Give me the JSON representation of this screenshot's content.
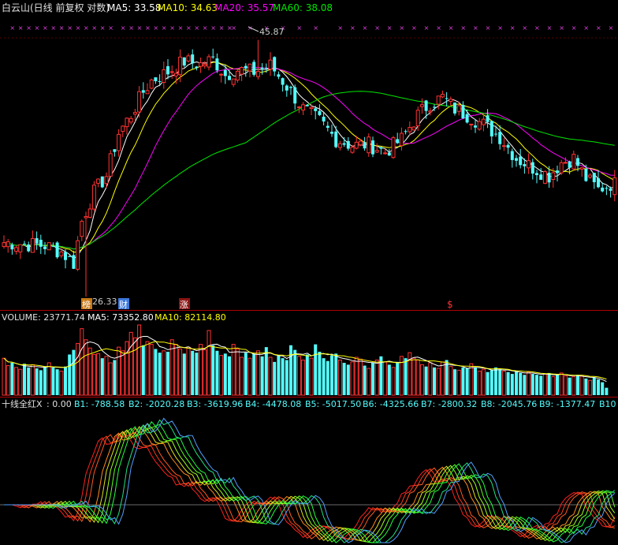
{
  "header": {
    "title": "白云山(日线 前复权 对数)",
    "ma5_label": "MA5: 33.58",
    "ma10_label": "MA10: 34.63",
    "ma20_label": "MA20: 35.57",
    "ma60_label": "MA60: 38.08"
  },
  "volume_header": {
    "volume_label": "VOLUME: 23771.74",
    "ma5_label": "MA5: 73352.80",
    "ma10_label": "MA10: 82114.80"
  },
  "indicator_header": {
    "name": "十线全红X",
    "items": [
      ": 0.00",
      "B1: -788.58",
      "B2: -2020.28",
      "B3: -3619.96",
      "B4: -4478.08",
      "B5: -5017.50",
      "B6: -4325.66",
      "B7: -2800.32",
      "B8: -2045.76",
      "B9: -1377.47",
      "B10"
    ]
  },
  "annotations": {
    "high_label": "45.87",
    "low_label": "26.33",
    "tag_bang": "榜",
    "tag_cai": "财",
    "tag_zhang": "涨",
    "tag_dollar": "$"
  },
  "colors": {
    "up": "#ff3232",
    "down": "#54fcfc",
    "ma5": "#ffffff",
    "ma10": "#ffff00",
    "ma20": "#ff00ff",
    "ma60": "#00e600",
    "marker": "#e040e0"
  },
  "chart_data": [
    {
      "type": "candlestick",
      "title": "白云山(日线 前复权 对数)",
      "scale": "log",
      "ylim": [
        25.8,
        48.0
      ],
      "summary": {
        "high": 45.87,
        "low": 26.33
      },
      "series": [
        {
          "name": "MA5",
          "last": 33.58
        },
        {
          "name": "MA10",
          "last": 34.63
        },
        {
          "name": "MA20",
          "last": 35.57
        },
        {
          "name": "MA60",
          "last": 38.08
        }
      ],
      "key_closes": [
        [
          0,
          29.6
        ],
        [
          10,
          29.4
        ],
        [
          14,
          29.0
        ],
        [
          17,
          28.3
        ],
        [
          19,
          31.0
        ],
        [
          22,
          33.0
        ],
        [
          25,
          34.2
        ],
        [
          28,
          37.5
        ],
        [
          31,
          39.0
        ],
        [
          34,
          41.0
        ],
        [
          36,
          42.0
        ],
        [
          40,
          42.8
        ],
        [
          44,
          43.8
        ],
        [
          48,
          43.5
        ],
        [
          51,
          44.0
        ],
        [
          54,
          42.5
        ],
        [
          57,
          43.0
        ],
        [
          61,
          42.8
        ],
        [
          65,
          43.4
        ],
        [
          69,
          41.5
        ],
        [
          73,
          39.5
        ],
        [
          77,
          38.5
        ],
        [
          81,
          37.0
        ],
        [
          85,
          36.5
        ],
        [
          89,
          36.6
        ],
        [
          93,
          36.0
        ],
        [
          97,
          37.0
        ],
        [
          101,
          39.0
        ],
        [
          104,
          40.0
        ],
        [
          107,
          40.5
        ],
        [
          110,
          39.5
        ],
        [
          113,
          39.0
        ],
        [
          117,
          38.2
        ],
        [
          121,
          37.2
        ],
        [
          125,
          35.5
        ],
        [
          129,
          34.8
        ],
        [
          133,
          34.2
        ],
        [
          136,
          35.2
        ],
        [
          139,
          35.5
        ],
        [
          142,
          34.0
        ],
        [
          145,
          33.2
        ],
        [
          148,
          33.6
        ]
      ]
    },
    {
      "type": "bar",
      "title": "VOLUME",
      "values": [
        40,
        32,
        35,
        30,
        28,
        34,
        30,
        33,
        29,
        27,
        31,
        35,
        30,
        28,
        26,
        31,
        44,
        49,
        56,
        72,
        60,
        51,
        44,
        45,
        40,
        42,
        35,
        38,
        52,
        48,
        58,
        68,
        62,
        76,
        54,
        58,
        55,
        50,
        46,
        48,
        47,
        60,
        55,
        50,
        45,
        52,
        48,
        46,
        55,
        49,
        70,
        54,
        48,
        43,
        45,
        42,
        55,
        50,
        41,
        46,
        40,
        45,
        48,
        42,
        52,
        41,
        36,
        43,
        40,
        38,
        54,
        49,
        42,
        38,
        44,
        40,
        55,
        47,
        40,
        37,
        43,
        45,
        38,
        35,
        33,
        36,
        41,
        39,
        32,
        29,
        35,
        38,
        42,
        36,
        33,
        30,
        36,
        42,
        40,
        46,
        40,
        38,
        33,
        31,
        35,
        30,
        29,
        36,
        38,
        31,
        28,
        27,
        30,
        29,
        34,
        30,
        26,
        28,
        25,
        27,
        30,
        28,
        26,
        25,
        23,
        26,
        24,
        22,
        25,
        23,
        22,
        21,
        23,
        24,
        20,
        22,
        24,
        21,
        19,
        20,
        22,
        21,
        18,
        16,
        19,
        17,
        14,
        8
      ],
      "series": [
        {
          "name": "MA5",
          "last": 73352.8
        },
        {
          "name": "MA10",
          "last": 82114.8
        }
      ]
    },
    {
      "type": "line",
      "title": "十线全红X",
      "series": [
        {
          "name": "B1",
          "last": -788.58
        },
        {
          "name": "B2",
          "last": -2020.28
        },
        {
          "name": "B3",
          "last": -3619.96
        },
        {
          "name": "B4",
          "last": -4478.08
        },
        {
          "name": "B5",
          "last": -5017.5
        },
        {
          "name": "B6",
          "last": -4325.66
        },
        {
          "name": "B7",
          "last": -2800.32
        },
        {
          "name": "B8",
          "last": -2045.76
        },
        {
          "name": "B9",
          "last": -1377.47
        }
      ]
    }
  ]
}
